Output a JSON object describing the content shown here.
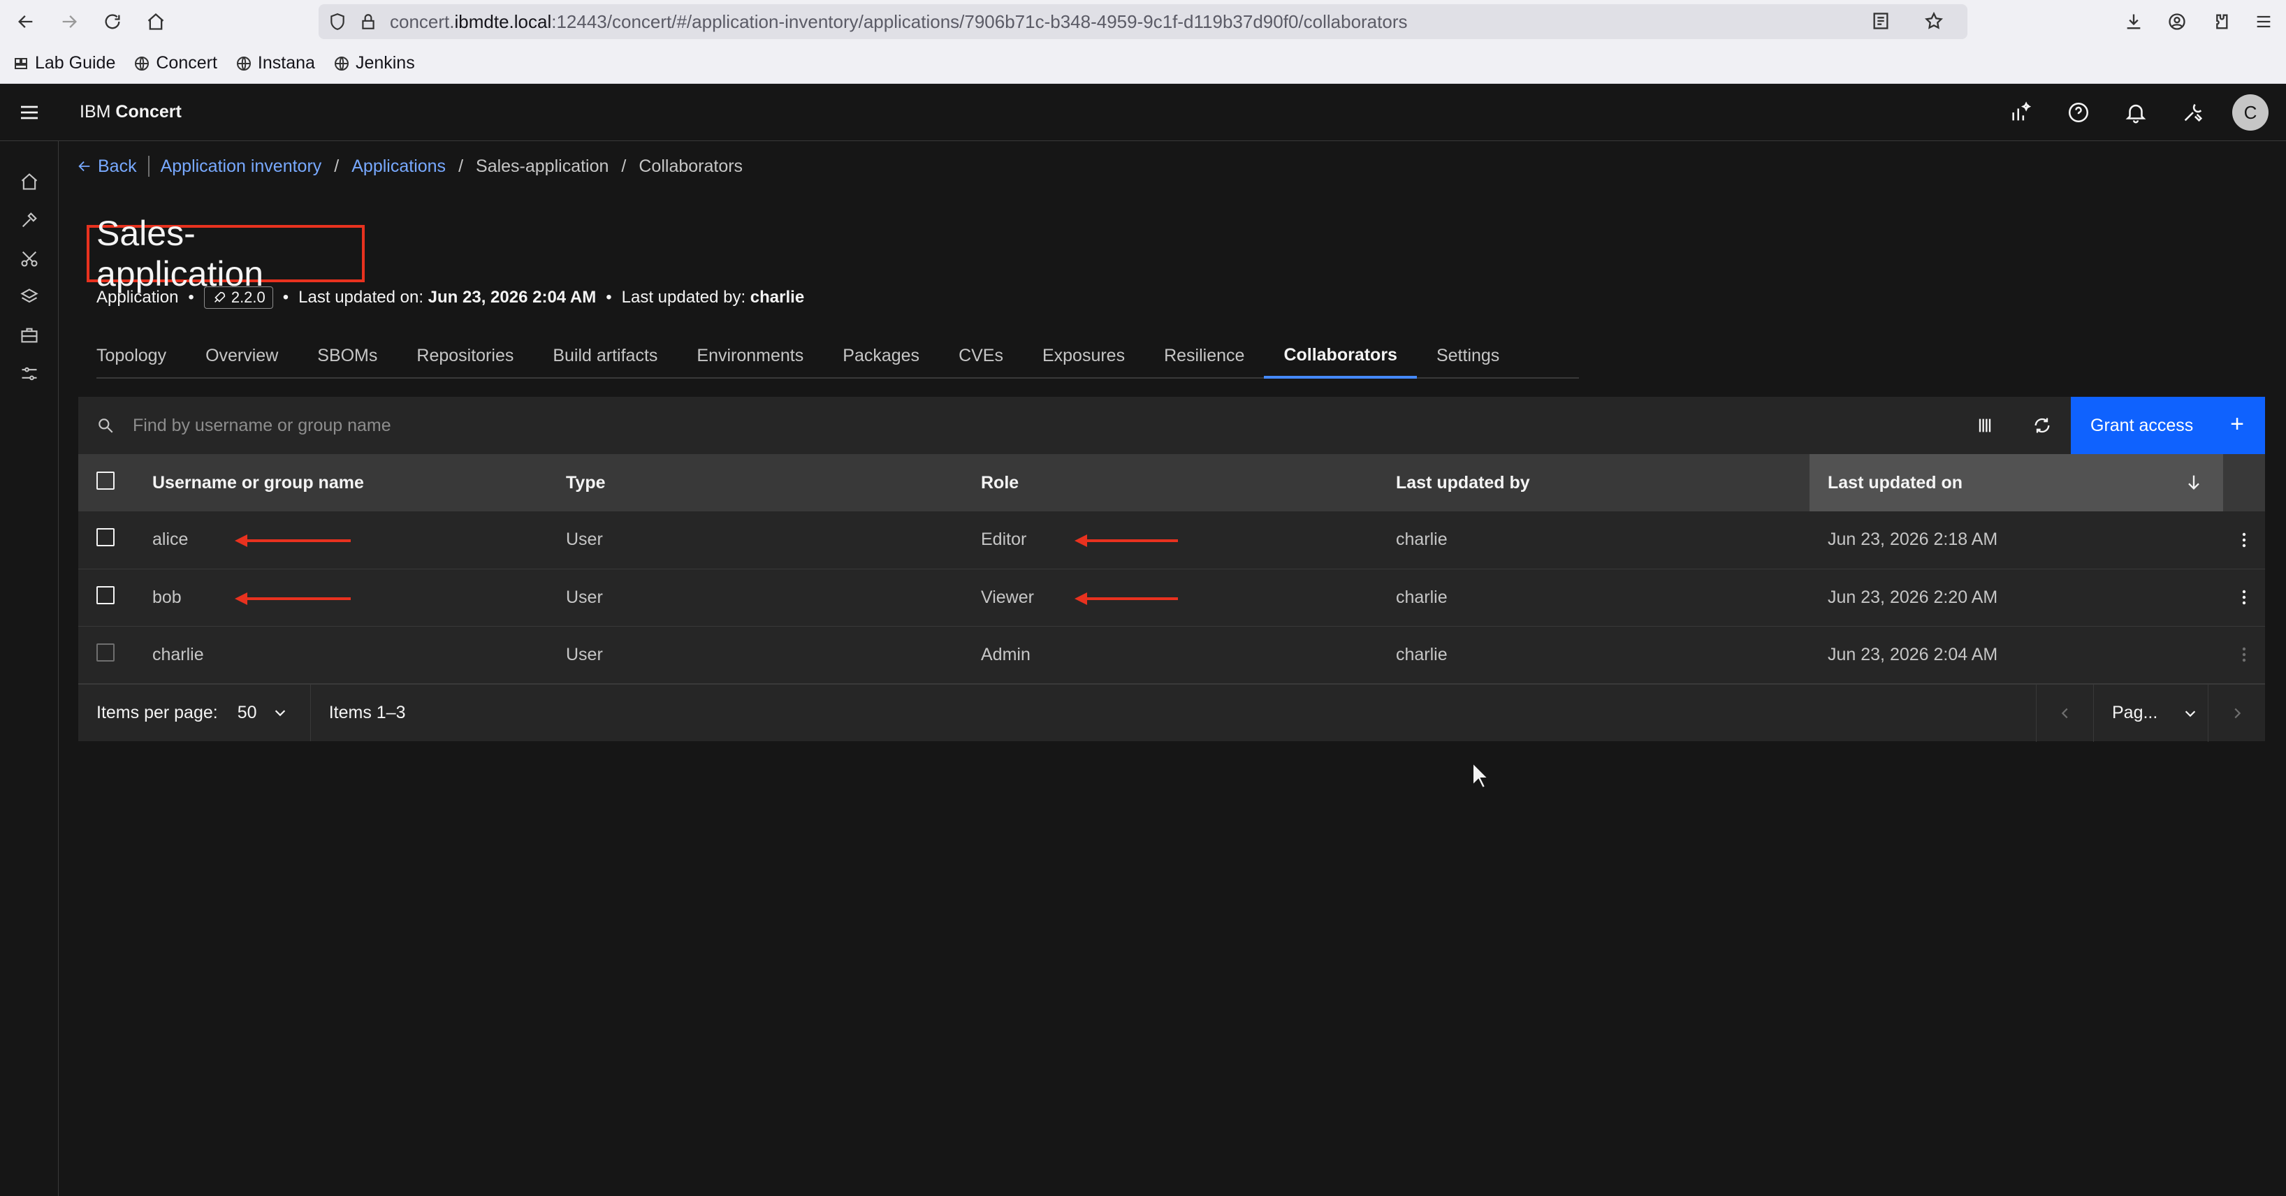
{
  "browser": {
    "url_prefix": "concert.",
    "url_host": "ibmdte.local",
    "url_rest": ":12443/concert/#/application-inventory/applications/7906b71c-b348-4959-9c1f-d119b37d90f0/collaborators",
    "bookmarks": [
      "Lab Guide",
      "Concert",
      "Instana",
      "Jenkins"
    ]
  },
  "header": {
    "brand": "IBM",
    "product": "Concert",
    "avatar_initial": "C"
  },
  "breadcrumb": {
    "back": "Back",
    "items": [
      "Application inventory",
      "Applications",
      "Sales-application",
      "Collaborators"
    ]
  },
  "page": {
    "title": "Sales-application",
    "meta_type": "Application",
    "version": "2.2.0",
    "updated_on_label": "Last updated on:",
    "updated_on": "Jun 23, 2026 2:04 AM",
    "updated_by_label": "Last updated by:",
    "updated_by": "charlie"
  },
  "tabs": [
    "Topology",
    "Overview",
    "SBOMs",
    "Repositories",
    "Build artifacts",
    "Environments",
    "Packages",
    "CVEs",
    "Exposures",
    "Resilience",
    "Collaborators",
    "Settings"
  ],
  "active_tab": "Collaborators",
  "search": {
    "placeholder": "Find by username or group name"
  },
  "grant_button": {
    "label": "Grant access",
    "icon": "+"
  },
  "table": {
    "columns": [
      "Username or group name",
      "Type",
      "Role",
      "Last updated by",
      "Last updated on"
    ],
    "rows": [
      {
        "name": "alice",
        "type": "User",
        "role": "Editor",
        "updated_by": "charlie",
        "updated_on": "Jun 23, 2026 2:18 AM"
      },
      {
        "name": "bob",
        "type": "User",
        "role": "Viewer",
        "updated_by": "charlie",
        "updated_on": "Jun 23, 2026 2:20 AM"
      },
      {
        "name": "charlie",
        "type": "User",
        "role": "Admin",
        "updated_by": "charlie",
        "updated_on": "Jun 23, 2026 2:04 AM"
      }
    ]
  },
  "pagination": {
    "items_per_page_label": "Items per page:",
    "items_per_page": "50",
    "range": "Items 1–3",
    "page_placeholder": "Pag..."
  },
  "colors": {
    "accent": "#0f62fe",
    "link": "#78a9ff",
    "highlight_red": "#e8321f"
  }
}
